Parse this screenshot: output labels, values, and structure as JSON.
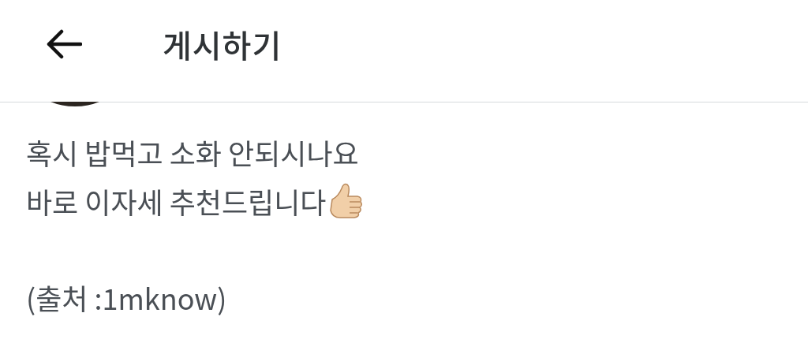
{
  "header": {
    "title": "게시하기"
  },
  "post": {
    "lines": [
      {
        "text": "혹시 밥먹고 소화 안되시나요",
        "trailing_icon": false
      },
      {
        "text": "바로 이자세 추천드립니다",
        "trailing_icon": true
      }
    ],
    "source": "(출처 :1mknow)"
  }
}
